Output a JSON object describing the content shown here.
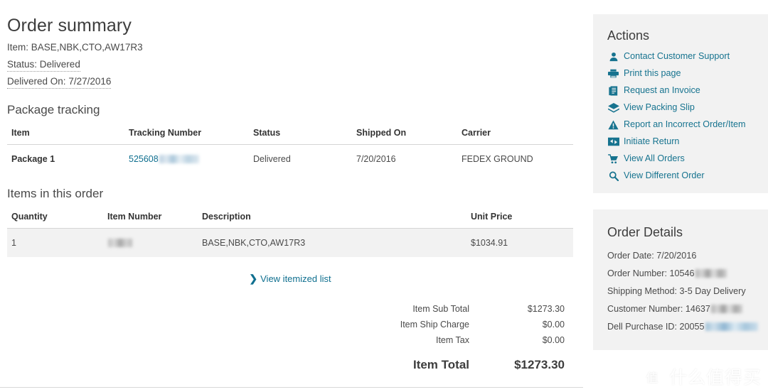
{
  "order_summary": {
    "title": "Order summary",
    "item_label": "Item:",
    "item_value": "BASE,NBK,CTO,AW17R3",
    "status_label": "Status:",
    "status_value": "Delivered",
    "delivered_on_label": "Delivered On:",
    "delivered_on_value": "7/27/2016"
  },
  "package_tracking": {
    "title": "Package tracking",
    "columns": [
      "Item",
      "Tracking Number",
      "Status",
      "Shipped On",
      "Carrier"
    ],
    "rows": [
      {
        "item": "Package 1",
        "tracking_number_visible": "525608",
        "tracking_number_redacted": true,
        "status": "Delivered",
        "shipped_on": "7/20/2016",
        "carrier": "FEDEX GROUND"
      }
    ]
  },
  "items_in_order": {
    "title": "Items in this order",
    "columns": [
      "Quantity",
      "Item Number",
      "Description",
      "Unit Price"
    ],
    "rows": [
      {
        "quantity": "1",
        "item_number_visible": "",
        "item_number_redacted": true,
        "description": "BASE,NBK,CTO,AW17R3",
        "unit_price": "$1034.91"
      }
    ],
    "itemized_link": "View itemized list",
    "itemized_link_icon": "chevron-right-icon"
  },
  "totals": {
    "rows": [
      {
        "label": "Item Sub Total",
        "value": "$1273.30"
      },
      {
        "label": "Item Ship Charge",
        "value": "$0.00"
      },
      {
        "label": "Item Tax",
        "value": "$0.00"
      }
    ],
    "total": {
      "label": "Item Total",
      "value": "$1273.30"
    }
  },
  "actions": {
    "title": "Actions",
    "items": [
      {
        "label": "Contact Customer Support",
        "icon": "person-icon"
      },
      {
        "label": "Print this page",
        "icon": "printer-icon"
      },
      {
        "label": "Request an Invoice",
        "icon": "document-icon"
      },
      {
        "label": "View Packing Slip",
        "icon": "layers-icon"
      },
      {
        "label": "Report an Incorrect Order/Item",
        "icon": "warning-triangle-icon"
      },
      {
        "label": "Initiate Return",
        "icon": "return-arrows-icon"
      },
      {
        "label": "View All Orders",
        "icon": "cart-icon"
      },
      {
        "label": "View Different Order",
        "icon": "search-icon"
      }
    ]
  },
  "order_details": {
    "title": "Order Details",
    "lines": [
      {
        "label": "Order Date:",
        "value": "7/20/2016",
        "redacted": false
      },
      {
        "label": "Order Number:",
        "value": "10546",
        "redacted": true
      },
      {
        "label": "Shipping Method:",
        "value": "3-5 Day Delivery",
        "redacted": false
      },
      {
        "label": "Customer Number:",
        "value": "14637",
        "redacted": true
      },
      {
        "label": "Dell Purchase ID:",
        "value": "20055",
        "redacted": true
      }
    ]
  },
  "watermark": {
    "mark": "值",
    "text": "什么值得买"
  },
  "colors": {
    "link": "#16738f",
    "panel_bg": "#f2f2f2",
    "zebra_row": "#f2f2f2",
    "text": "#4a4a4a",
    "heading": "#3d3d3d",
    "rule": "#d4d4d4"
  }
}
